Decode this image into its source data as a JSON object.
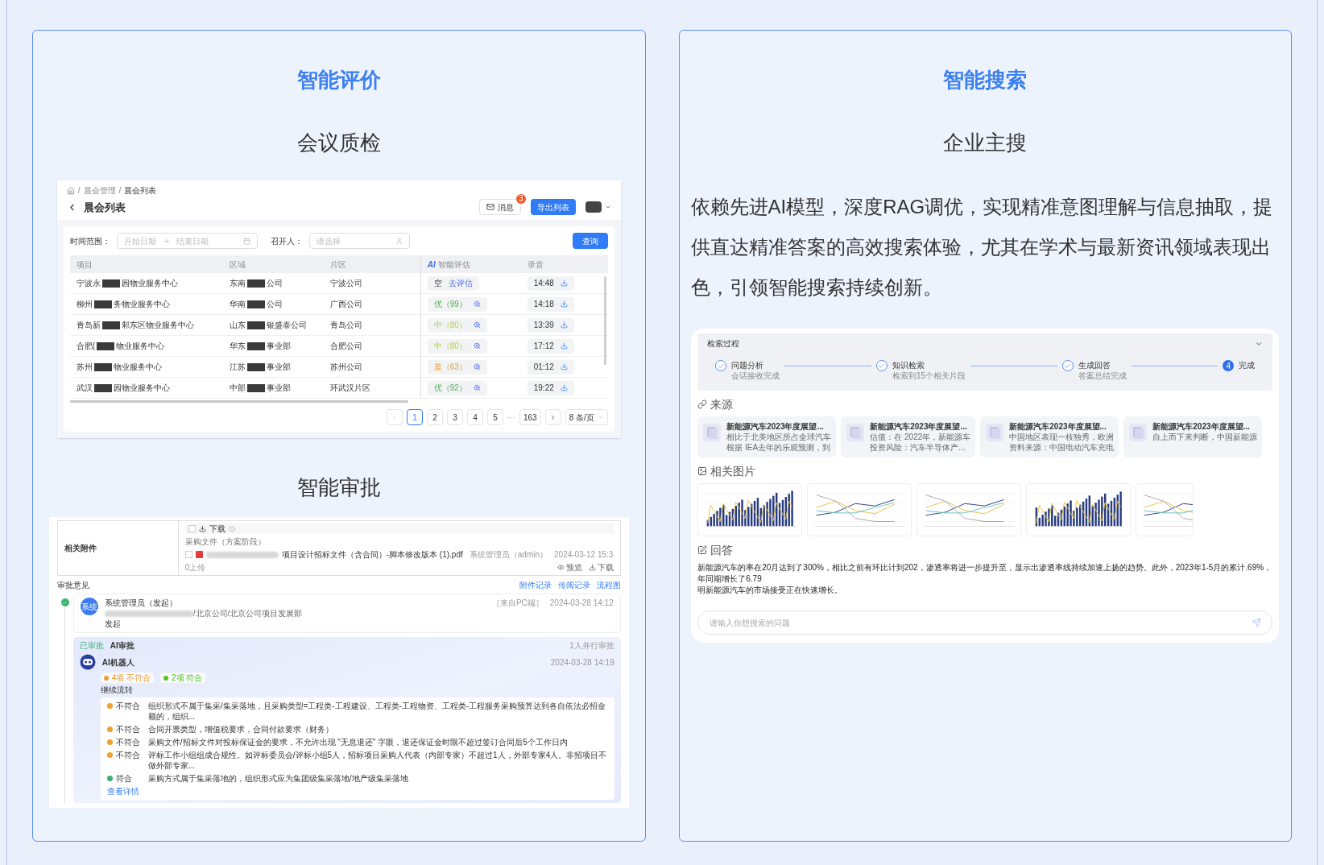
{
  "left_card": {
    "title": "智能评价",
    "meeting": {
      "subtitle": "会议质检",
      "screen": {
        "breadcrumb": [
          "晨会管理",
          "晨会列表"
        ],
        "breadcrumb_separator": "/",
        "title": "晨会列表",
        "message_button": {
          "label": "消息",
          "badge": "3"
        },
        "export_button": "导出列表",
        "filters": {
          "time_label": "时间范围：",
          "start_placeholder": "开始日期",
          "end_placeholder": "结束日期",
          "host_label": "召开人：",
          "host_placeholder": "请选择"
        },
        "query_button": "查询",
        "columns": [
          "项目",
          "区域",
          "片区",
          "智能评估",
          "录音"
        ],
        "ai_column_tag": "AI",
        "rows": [
          {
            "project": [
              "宁波永",
              "园物业服务中心"
            ],
            "region": [
              "东南",
              "公司"
            ],
            "area": "宁波公司",
            "grade": {
              "kind": "pending",
              "label": "空",
              "link": "去评估"
            },
            "duration": "14:48"
          },
          {
            "project": [
              "柳州",
              "务物业服务中心"
            ],
            "region": [
              "华南",
              "公司"
            ],
            "area": "广西公司",
            "grade": {
              "kind": "good",
              "label": "优（99）"
            },
            "duration": "14:18"
          },
          {
            "project": [
              "青岛新",
              "邾东区物业服务中心"
            ],
            "region": [
              "山东",
              "银盛泰公司"
            ],
            "area": "青岛公司",
            "grade": {
              "kind": "medium",
              "label": "中（80）"
            },
            "duration": "13:39"
          },
          {
            "project": [
              "合肥(",
              "物业服务中心"
            ],
            "region": [
              "华东",
              "事业部"
            ],
            "area": "合肥公司",
            "grade": {
              "kind": "medium",
              "label": "中（80）"
            },
            "duration": "17:12"
          },
          {
            "project": [
              "苏州",
              "物业服务中心"
            ],
            "region": [
              "江苏",
              "事业部"
            ],
            "area": "苏州公司",
            "grade": {
              "kind": "poor",
              "label": "差（63）"
            },
            "duration": "01:12"
          },
          {
            "project": [
              "武汉",
              "园物业服务中心"
            ],
            "region": [
              "中部",
              "事业部"
            ],
            "area": "环武汉片区",
            "grade": {
              "kind": "good",
              "label": "优（92）"
            },
            "duration": "19:22"
          }
        ],
        "pagination": {
          "pages": [
            {
              "label": "1",
              "selected": true
            },
            {
              "label": "2",
              "selected": false
            },
            {
              "label": "3",
              "selected": false
            },
            {
              "label": "4",
              "selected": false
            },
            {
              "label": "5",
              "selected": false
            }
          ],
          "ellipsis": "···",
          "last": "163",
          "page_size": "8 条/页"
        }
      }
    },
    "approval": {
      "subtitle": "智能审批",
      "screen": {
        "attachments": {
          "label": "相关附件",
          "select_all_checked": false,
          "download": "下载",
          "group": "采购文件（方案阶段）",
          "file": {
            "checked": false,
            "name": "项目设计招标文件（含合同）-脚本修改版本 (1).pdf",
            "uploader": "系统管理员（admin）",
            "time": "2024-03-12 15:3"
          },
          "upload_count": "0上传",
          "actions": [
            "预览",
            "下载"
          ]
        },
        "opinions_label": "审批意见",
        "links": [
          "附件记录",
          "传阅记录",
          "流程图"
        ],
        "initiator": {
          "avatar": "系统",
          "name": "系统管理员（发起）",
          "dept": "/北京公司/北京公司项目发展部",
          "action": "发起",
          "source": "［来自PC端］",
          "time": "2024-03-28 14:12"
        },
        "ai_step": {
          "status": "已审批",
          "title": "AI审批",
          "mode": "1人并行审批",
          "robot": "AI机器人",
          "time": "2024-03-28 14:19",
          "tags": [
            {
              "label": "4项 不符合",
              "color": "#f0a030"
            },
            {
              "label": "2项 符合",
              "color": "#52c41a"
            }
          ],
          "result": "继续流转",
          "checks": [
            {
              "passed": false,
              "label": "不符合",
              "text": "组织形式不属于集采/集采落地，且采购类型=工程类-工程建设、工程类-工程物资、工程类-工程服务采购预算达到各自依法必招金额的，组织..."
            },
            {
              "passed": false,
              "label": "不符合",
              "text": "合同开票类型，增值税要求，合同付款要求（财务）"
            },
            {
              "passed": false,
              "label": "不符合",
              "text": "采购文件/招标文件对投标保证金的要求，不允许出现 \"无息退还\" 字眼，退还保证金时限不超过签订合同后5个工作日内"
            },
            {
              "passed": false,
              "label": "不符合",
              "text": "评标工作小组组成合规性。如评标委员会/评标小组5人，招标项目采购人代表（内部专家）不超过1人，外部专家4人。非招项目不做外部专家..."
            },
            {
              "passed": true,
              "label": "符合",
              "text": "采购方式属于集采落地的，组织形式应为集团级集采落地/地产级集采落地"
            }
          ],
          "details_link": "查看详情"
        }
      }
    }
  },
  "right_card": {
    "title": "智能搜索",
    "subtitle": "企业主搜",
    "description": "依赖先进AI模型，深度RAG调优，实现精准意图理解与信息抽取，提供直达精准答案的高效搜索体验，尤其在学术与最新资讯领域表现出色，引领智能搜索持续创新。",
    "screen": {
      "process": {
        "title": "检索过程",
        "expanded": true,
        "steps": [
          {
            "label": "问题分析",
            "detail": "会话接收完成",
            "done": true
          },
          {
            "label": "知识检索",
            "detail": "检索到15个相关片段",
            "done": true
          },
          {
            "label": "生成回答",
            "detail": "答案总结完成",
            "done": true
          },
          {
            "label": "完成",
            "index": "4",
            "done": false
          }
        ]
      },
      "sources": {
        "title": "来源",
        "items": [
          {
            "title": "新能源汽车2023年度展望...",
            "lines": [
              "相比于北美地区所占全球汽车",
              "根据 IEA去年的乐观预测，到"
            ]
          },
          {
            "title": "新能源汽车2023年度展望...",
            "lines": [
              "估值：在 2022年，新能源车",
              "投资风险：汽车半导体产..."
            ]
          },
          {
            "title": "新能源汽车2023年度展望...",
            "lines": [
              "中国地区表现一枝独秀，欧洲",
              "资料来源：中国电动汽车充电"
            ]
          },
          {
            "title": "新能源汽车2023年度展望...",
            "lines": [
              "自上而下来判断，中国新能源"
            ]
          }
        ]
      },
      "images": {
        "title": "相关图片",
        "items": [
          {
            "kind": "bars"
          },
          {
            "kind": "lines"
          },
          {
            "kind": "lines"
          },
          {
            "kind": "bars"
          },
          {
            "kind": "lines"
          }
        ]
      },
      "answer": {
        "title": "回答",
        "lines": [
          "新能源汽车的率在20月达到了300%，相比之前有环比计到202，渗透率将进一步提升至，显示出渗透率线持续加速上扬的趋势。此外，2023年1-5月的累计.69%，年同期增长了6.79",
          "明新能源汽车的市场接受正在快速增长。"
        ]
      },
      "input": {
        "placeholder": "请输入你想搜索的问题"
      }
    }
  }
}
